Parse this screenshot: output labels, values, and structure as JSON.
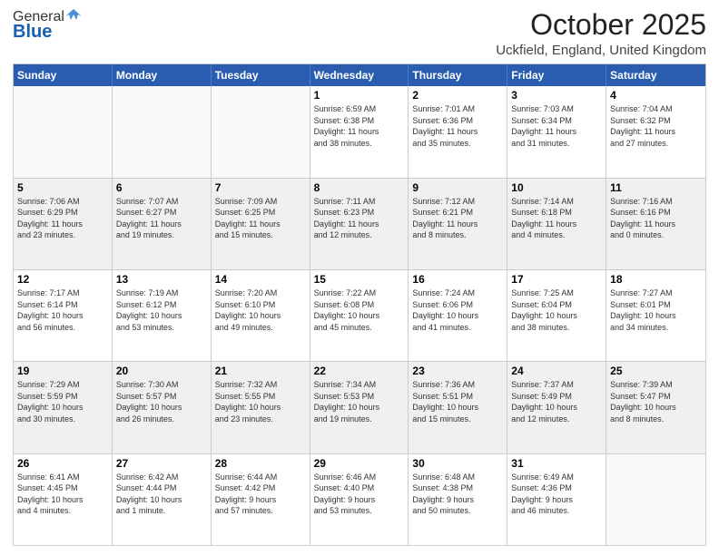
{
  "logo": {
    "general": "General",
    "blue": "Blue"
  },
  "title": "October 2025",
  "location": "Uckfield, England, United Kingdom",
  "weekdays": [
    "Sunday",
    "Monday",
    "Tuesday",
    "Wednesday",
    "Thursday",
    "Friday",
    "Saturday"
  ],
  "rows": [
    [
      {
        "day": "",
        "info": ""
      },
      {
        "day": "",
        "info": ""
      },
      {
        "day": "",
        "info": ""
      },
      {
        "day": "1",
        "info": "Sunrise: 6:59 AM\nSunset: 6:38 PM\nDaylight: 11 hours\nand 38 minutes."
      },
      {
        "day": "2",
        "info": "Sunrise: 7:01 AM\nSunset: 6:36 PM\nDaylight: 11 hours\nand 35 minutes."
      },
      {
        "day": "3",
        "info": "Sunrise: 7:03 AM\nSunset: 6:34 PM\nDaylight: 11 hours\nand 31 minutes."
      },
      {
        "day": "4",
        "info": "Sunrise: 7:04 AM\nSunset: 6:32 PM\nDaylight: 11 hours\nand 27 minutes."
      }
    ],
    [
      {
        "day": "5",
        "info": "Sunrise: 7:06 AM\nSunset: 6:29 PM\nDaylight: 11 hours\nand 23 minutes."
      },
      {
        "day": "6",
        "info": "Sunrise: 7:07 AM\nSunset: 6:27 PM\nDaylight: 11 hours\nand 19 minutes."
      },
      {
        "day": "7",
        "info": "Sunrise: 7:09 AM\nSunset: 6:25 PM\nDaylight: 11 hours\nand 15 minutes."
      },
      {
        "day": "8",
        "info": "Sunrise: 7:11 AM\nSunset: 6:23 PM\nDaylight: 11 hours\nand 12 minutes."
      },
      {
        "day": "9",
        "info": "Sunrise: 7:12 AM\nSunset: 6:21 PM\nDaylight: 11 hours\nand 8 minutes."
      },
      {
        "day": "10",
        "info": "Sunrise: 7:14 AM\nSunset: 6:18 PM\nDaylight: 11 hours\nand 4 minutes."
      },
      {
        "day": "11",
        "info": "Sunrise: 7:16 AM\nSunset: 6:16 PM\nDaylight: 11 hours\nand 0 minutes."
      }
    ],
    [
      {
        "day": "12",
        "info": "Sunrise: 7:17 AM\nSunset: 6:14 PM\nDaylight: 10 hours\nand 56 minutes."
      },
      {
        "day": "13",
        "info": "Sunrise: 7:19 AM\nSunset: 6:12 PM\nDaylight: 10 hours\nand 53 minutes."
      },
      {
        "day": "14",
        "info": "Sunrise: 7:20 AM\nSunset: 6:10 PM\nDaylight: 10 hours\nand 49 minutes."
      },
      {
        "day": "15",
        "info": "Sunrise: 7:22 AM\nSunset: 6:08 PM\nDaylight: 10 hours\nand 45 minutes."
      },
      {
        "day": "16",
        "info": "Sunrise: 7:24 AM\nSunset: 6:06 PM\nDaylight: 10 hours\nand 41 minutes."
      },
      {
        "day": "17",
        "info": "Sunrise: 7:25 AM\nSunset: 6:04 PM\nDaylight: 10 hours\nand 38 minutes."
      },
      {
        "day": "18",
        "info": "Sunrise: 7:27 AM\nSunset: 6:01 PM\nDaylight: 10 hours\nand 34 minutes."
      }
    ],
    [
      {
        "day": "19",
        "info": "Sunrise: 7:29 AM\nSunset: 5:59 PM\nDaylight: 10 hours\nand 30 minutes."
      },
      {
        "day": "20",
        "info": "Sunrise: 7:30 AM\nSunset: 5:57 PM\nDaylight: 10 hours\nand 26 minutes."
      },
      {
        "day": "21",
        "info": "Sunrise: 7:32 AM\nSunset: 5:55 PM\nDaylight: 10 hours\nand 23 minutes."
      },
      {
        "day": "22",
        "info": "Sunrise: 7:34 AM\nSunset: 5:53 PM\nDaylight: 10 hours\nand 19 minutes."
      },
      {
        "day": "23",
        "info": "Sunrise: 7:36 AM\nSunset: 5:51 PM\nDaylight: 10 hours\nand 15 minutes."
      },
      {
        "day": "24",
        "info": "Sunrise: 7:37 AM\nSunset: 5:49 PM\nDaylight: 10 hours\nand 12 minutes."
      },
      {
        "day": "25",
        "info": "Sunrise: 7:39 AM\nSunset: 5:47 PM\nDaylight: 10 hours\nand 8 minutes."
      }
    ],
    [
      {
        "day": "26",
        "info": "Sunrise: 6:41 AM\nSunset: 4:45 PM\nDaylight: 10 hours\nand 4 minutes."
      },
      {
        "day": "27",
        "info": "Sunrise: 6:42 AM\nSunset: 4:44 PM\nDaylight: 10 hours\nand 1 minute."
      },
      {
        "day": "28",
        "info": "Sunrise: 6:44 AM\nSunset: 4:42 PM\nDaylight: 9 hours\nand 57 minutes."
      },
      {
        "day": "29",
        "info": "Sunrise: 6:46 AM\nSunset: 4:40 PM\nDaylight: 9 hours\nand 53 minutes."
      },
      {
        "day": "30",
        "info": "Sunrise: 6:48 AM\nSunset: 4:38 PM\nDaylight: 9 hours\nand 50 minutes."
      },
      {
        "day": "31",
        "info": "Sunrise: 6:49 AM\nSunset: 4:36 PM\nDaylight: 9 hours\nand 46 minutes."
      },
      {
        "day": "",
        "info": ""
      }
    ]
  ]
}
